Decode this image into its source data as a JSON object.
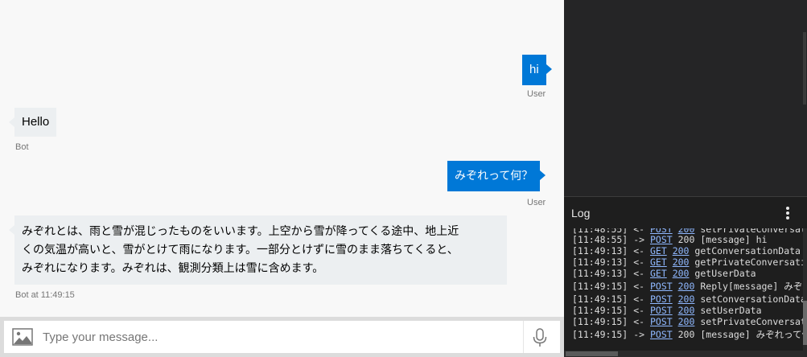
{
  "conversation": {
    "messages": [
      {
        "from": "user",
        "text": "hi",
        "meta": "User"
      },
      {
        "from": "bot",
        "text": "Hello",
        "meta": "Bot"
      },
      {
        "from": "user",
        "text": "みぞれって何？",
        "meta": "User"
      },
      {
        "from": "bot",
        "lines": [
          "みぞれとは、雨と雪が混じったものをいいます。上空から雪が降ってくる途中、地上近",
          "くの気温が高いと、雪がとけて雨になります。一部分とけずに雪のまま落ちてくると、",
          "みぞれになります。みぞれは、観測分類上は雪に含めます。"
        ],
        "meta": "Bot at 11:49:15"
      }
    ]
  },
  "input": {
    "placeholder": "Type your message...",
    "image_icon": "image-icon",
    "mic_icon": "microphone-icon"
  },
  "log": {
    "title": "Log",
    "menu_icon": "more-vertical-icon",
    "lines": [
      {
        "time": "[11:48:55]",
        "dir": "<-",
        "method": "POST",
        "status": "200",
        "status_link": true,
        "text": "setPrivateConversati"
      },
      {
        "time": "[11:48:55]",
        "dir": "->",
        "method": "POST",
        "status": "200",
        "status_link": false,
        "text": "[message] hi"
      },
      {
        "time": "[11:49:13]",
        "dir": "<-",
        "method": "GET",
        "status": "200",
        "status_link": true,
        "text": "getConversationData"
      },
      {
        "time": "[11:49:13]",
        "dir": "<-",
        "method": "GET",
        "status": "200",
        "status_link": true,
        "text": "getPrivateConversatio"
      },
      {
        "time": "[11:49:13]",
        "dir": "<-",
        "method": "GET",
        "status": "200",
        "status_link": true,
        "text": "getUserData"
      },
      {
        "time": "[11:49:15]",
        "dir": "<-",
        "method": "POST",
        "status": "200",
        "status_link": true,
        "text": "Reply[message] みぞれ"
      },
      {
        "time": "[11:49:15]",
        "dir": "<-",
        "method": "POST",
        "status": "200",
        "status_link": true,
        "text": "setConversationData"
      },
      {
        "time": "[11:49:15]",
        "dir": "<-",
        "method": "POST",
        "status": "200",
        "status_link": true,
        "text": "setUserData"
      },
      {
        "time": "[11:49:15]",
        "dir": "<-",
        "method": "POST",
        "status": "200",
        "status_link": true,
        "text": "setPrivateConversatio"
      },
      {
        "time": "[11:49:15]",
        "dir": "->",
        "method": "POST",
        "status": "200",
        "status_link": false,
        "text": "[message] みぞれって何"
      }
    ]
  },
  "colors": {
    "user_bubble": "#0078d7",
    "bot_bubble": "#eceff1",
    "log_link": "#8fb8ff"
  }
}
